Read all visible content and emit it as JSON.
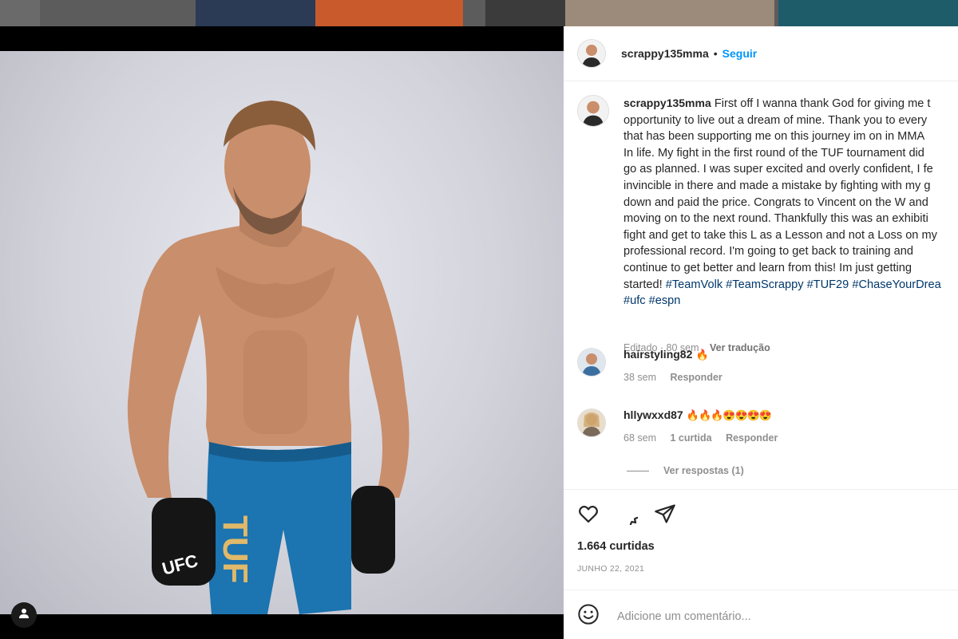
{
  "window": {
    "background_strip_colors": [
      "#6a6a6a",
      "#2b3a55",
      "#c85a2c",
      "#7a7a7a",
      "#3b3b3b",
      "#9c8b7a",
      "#1f5c6a"
    ]
  },
  "post": {
    "username": "scrappy135mma",
    "separator": "•",
    "follow_label": "Seguir",
    "user_tag_icon": "user-icon"
  },
  "caption": {
    "username": "scrappy135mma",
    "text": "First off I wanna thank God for giving me t\nopportunity to live out a dream of mine. Thank you to every\nthat has been supporting me on this journey im on in MMA\nIn life. My fight in the first round of the TUF tournament did\ngo as planned. I was super excited and overly confident, I fe\ninvincible in there and made a mistake by fighting with my g\ndown and paid the price. Congrats to Vincent on the W and\nmoving on to the next round. Thankfully this was an exhibiti\nfight and get to take this L as a Lesson and not a Loss on my\nprofessional record. I'm going to get back to training and\ncontinue to get better and learn from this! Im just getting\nstarted! ",
    "hashtags": "#TeamVolk #TeamScrappy #TUF29 #ChaseYourDrea\n#ufc #espn",
    "edited": "Editado · 80 sem",
    "translate": "Ver tradução"
  },
  "comments": [
    {
      "username": "hairstyling82",
      "text": "🔥",
      "time": "38 sem",
      "likes": "",
      "reply": "Responder"
    },
    {
      "username": "hllywxxd87",
      "text": "🔥🔥🔥😍😍😍😍",
      "time": "68 sem",
      "likes": "1 curtida",
      "reply": "Responder"
    }
  ],
  "view_replies": "Ver respostas (1)",
  "actions": {
    "like_icon": "heart-icon",
    "comment_icon": "comment-icon",
    "share_icon": "share-icon"
  },
  "likes": "1.664 curtidas",
  "date": "JUNHO 22, 2021",
  "add_comment": {
    "placeholder": "Adicione um comentário...",
    "emoji_icon": "emoji-icon"
  },
  "photo_text": {
    "glove_logo": "UFC",
    "shorts_logo": "TUF"
  }
}
